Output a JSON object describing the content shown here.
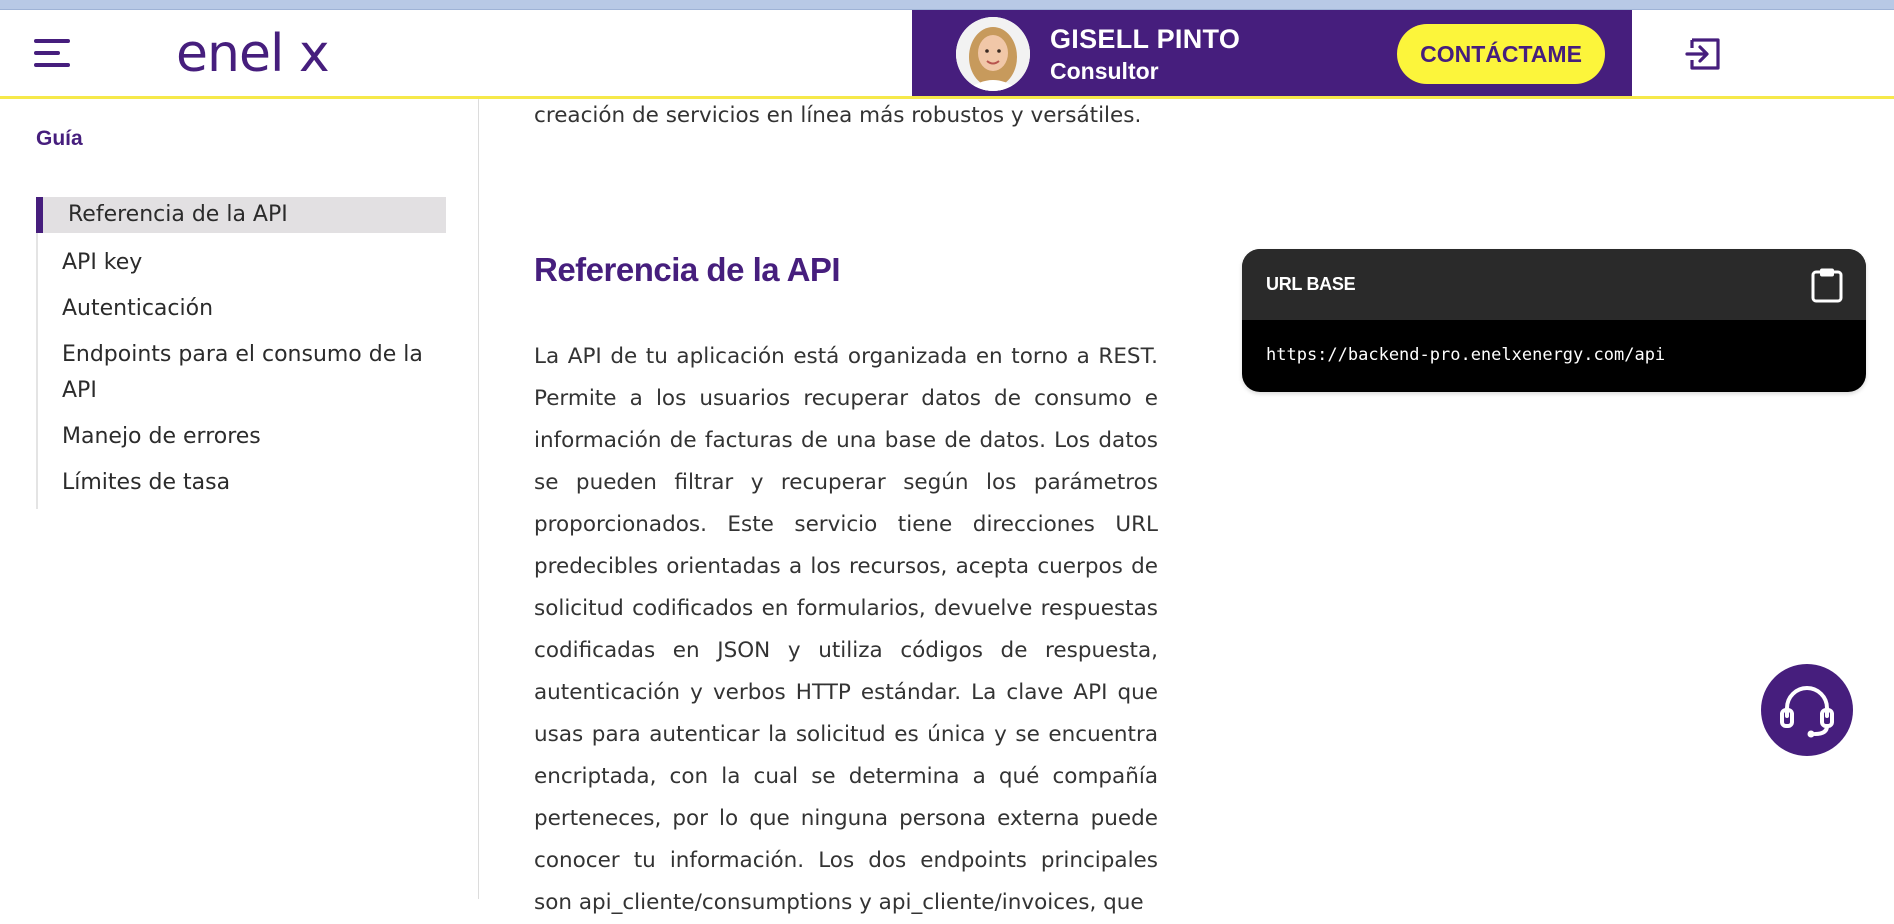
{
  "header": {
    "logo_text": "enel x",
    "consultant": {
      "name": "GISELL PINTO",
      "role": "Consultor",
      "contact_label": "CONTÁCTAME"
    }
  },
  "sidebar": {
    "title": "Guía",
    "items": [
      {
        "label": "Referencia de la API",
        "active": true
      },
      {
        "label": "API key"
      },
      {
        "label": "Autenticación"
      },
      {
        "label": "Endpoints para el consumo de la API"
      },
      {
        "label": "Manejo de errores"
      },
      {
        "label": "Límites de tasa"
      }
    ]
  },
  "main": {
    "intro_tail": "creación de servicios en línea más robustos y versátiles.",
    "section_title": "Referencia de la API",
    "paragraph": "La API de tu aplicación está organizada en torno a REST. Permite a los usuarios recuperar datos de consumo e información de facturas de una base de datos. Los datos se pueden filtrar y recuperar según los parámetros proporcionados. Este servicio tiene direcciones URL predecibles orientadas a los recursos, acepta cuerpos de solicitud codificados en formularios, devuelve respuestas codificadas en JSON y utiliza códigos de respuesta, autenticación y verbos HTTP estándar. La clave API que usas para autenticar la solicitud es única y se encuentra encriptada, con la cual se determina a qué compañía perteneces, por lo que ninguna persona externa puede conocer tu información. Los dos endpoints principales son api_cliente/consumptions y api_cliente/invoices, que"
  },
  "code_card": {
    "label": "URL BASE",
    "url": "https://backend-pro.enelxenergy.com/api"
  },
  "colors": {
    "brand_purple": "#461e7d",
    "accent_yellow": "#fcf53b",
    "header_underline": "#f6e94a"
  },
  "icons": [
    "menu-icon",
    "logout-icon",
    "clipboard-icon",
    "headset-icon"
  ]
}
